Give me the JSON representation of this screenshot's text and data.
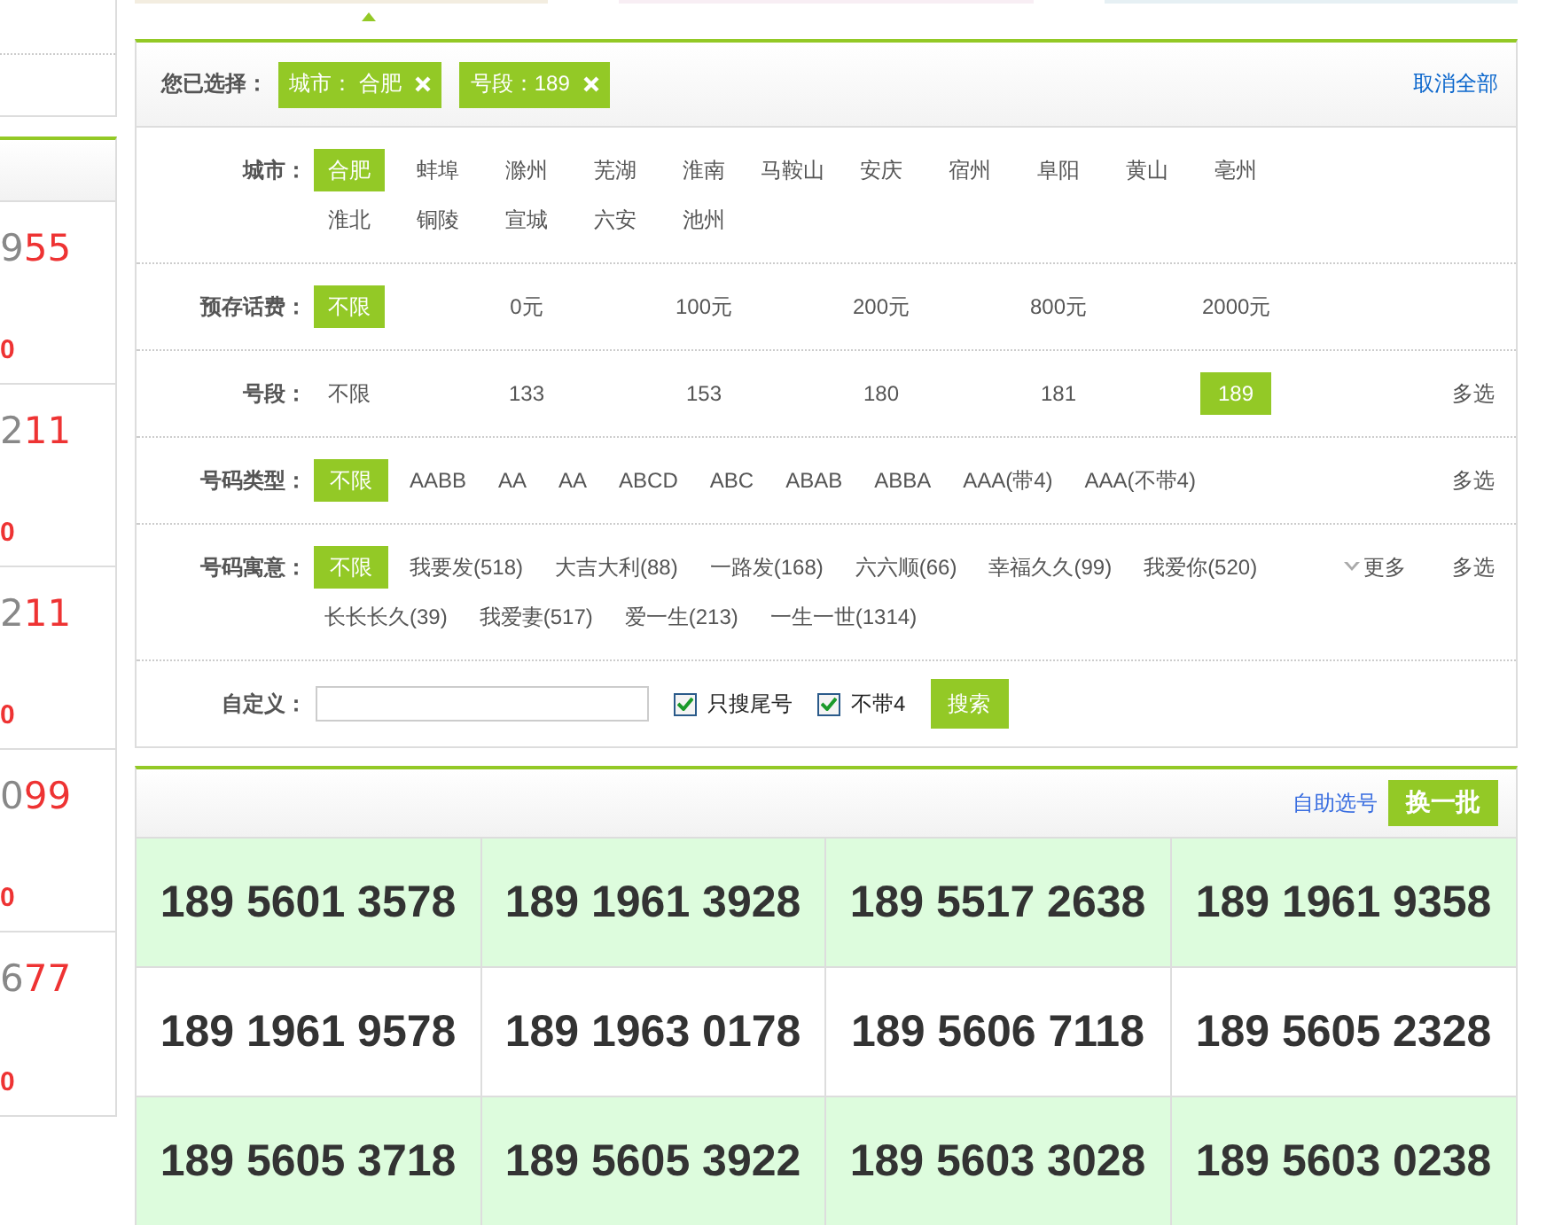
{
  "sidebar": {
    "items": [
      {
        "number_head": "9",
        "number_tail": "55",
        "price": "0"
      },
      {
        "number_head": "2",
        "number_tail": "11",
        "price": "0"
      },
      {
        "number_head": "2",
        "number_tail": "11",
        "price": "0"
      },
      {
        "number_head": "0",
        "number_tail": "99",
        "price": "0"
      },
      {
        "number_head": "6",
        "number_tail": "77",
        "price": "0"
      }
    ]
  },
  "filter": {
    "selected_label": "您已选择：",
    "chips": [
      {
        "text": "城市： 合肥"
      },
      {
        "text": "号段：189"
      }
    ],
    "clear_all": "取消全部",
    "rows": [
      {
        "label": "城市：",
        "kind": "compact",
        "options": [
          {
            "text": "合肥",
            "selected": true
          },
          {
            "text": "蚌埠",
            "selected": false
          },
          {
            "text": "滁州",
            "selected": false
          },
          {
            "text": "芜湖",
            "selected": false
          },
          {
            "text": "淮南",
            "selected": false
          },
          {
            "text": "马鞍山",
            "selected": false
          },
          {
            "text": "安庆",
            "selected": false
          },
          {
            "text": "宿州",
            "selected": false
          },
          {
            "text": "阜阳",
            "selected": false
          },
          {
            "text": "黄山",
            "selected": false
          },
          {
            "text": "亳州",
            "selected": false
          },
          {
            "text": "淮北",
            "selected": false
          },
          {
            "text": "铜陵",
            "selected": false
          },
          {
            "text": "宣城",
            "selected": false
          },
          {
            "text": "六安",
            "selected": false
          },
          {
            "text": "池州",
            "selected": false
          }
        ]
      },
      {
        "label": "预存话费：",
        "kind": "wide",
        "options": [
          {
            "text": "不限",
            "selected": true
          },
          {
            "text": "0元",
            "selected": false
          },
          {
            "text": "100元",
            "selected": false
          },
          {
            "text": "200元",
            "selected": false
          },
          {
            "text": "800元",
            "selected": false
          },
          {
            "text": "2000元",
            "selected": false
          }
        ]
      },
      {
        "label": "号段：",
        "kind": "wide",
        "multi": "多选",
        "options": [
          {
            "text": "不限",
            "selected": false
          },
          {
            "text": "133",
            "selected": false
          },
          {
            "text": "153",
            "selected": false
          },
          {
            "text": "180",
            "selected": false
          },
          {
            "text": "181",
            "selected": false
          },
          {
            "text": "189",
            "selected": true
          }
        ]
      },
      {
        "label": "号码类型：",
        "kind": "flow",
        "multi": "多选",
        "options": [
          {
            "text": "不限",
            "selected": true
          },
          {
            "text": "AABB",
            "selected": false
          },
          {
            "text": "AA",
            "selected": false
          },
          {
            "text": "AA",
            "selected": false
          },
          {
            "text": "ABCD",
            "selected": false
          },
          {
            "text": "ABC",
            "selected": false
          },
          {
            "text": "ABAB",
            "selected": false
          },
          {
            "text": "ABBA",
            "selected": false
          },
          {
            "text": "AAA(带4)",
            "selected": false
          },
          {
            "text": "AAA(不带4)",
            "selected": false
          }
        ]
      },
      {
        "label": "号码寓意：",
        "kind": "flow",
        "more": "更多",
        "multi": "多选",
        "options": [
          {
            "text": "不限",
            "selected": true
          },
          {
            "text": "我要发(518)",
            "selected": false
          },
          {
            "text": "大吉大利(88)",
            "selected": false
          },
          {
            "text": "一路发(168)",
            "selected": false
          },
          {
            "text": "六六顺(66)",
            "selected": false
          },
          {
            "text": "幸福久久(99)",
            "selected": false
          },
          {
            "text": "我爱你(520)",
            "selected": false
          },
          {
            "text": "长长长久(39)",
            "selected": false
          },
          {
            "text": "我爱妻(517)",
            "selected": false
          },
          {
            "text": "爱一生(213)",
            "selected": false
          },
          {
            "text": "一生一世(1314)",
            "selected": false
          }
        ]
      }
    ],
    "custom": {
      "label": "自定义：",
      "checkboxes": [
        {
          "label": "只搜尾号",
          "checked": true
        },
        {
          "label": "不带4",
          "checked": true
        }
      ],
      "search_button": "搜索"
    }
  },
  "results": {
    "self_select": "自助选号",
    "refresh_button": "换一批",
    "rows": [
      [
        "189 5601 3578",
        "189 1961 3928",
        "189 5517 2638",
        "189 1961 9358"
      ],
      [
        "189 1961 9578",
        "189 1963 0178",
        "189 5606 7118",
        "189 5605 2328"
      ],
      [
        "189 5605 3718",
        "189 5605 3922",
        "189 5603 3028",
        "189 5603 0238"
      ]
    ]
  }
}
